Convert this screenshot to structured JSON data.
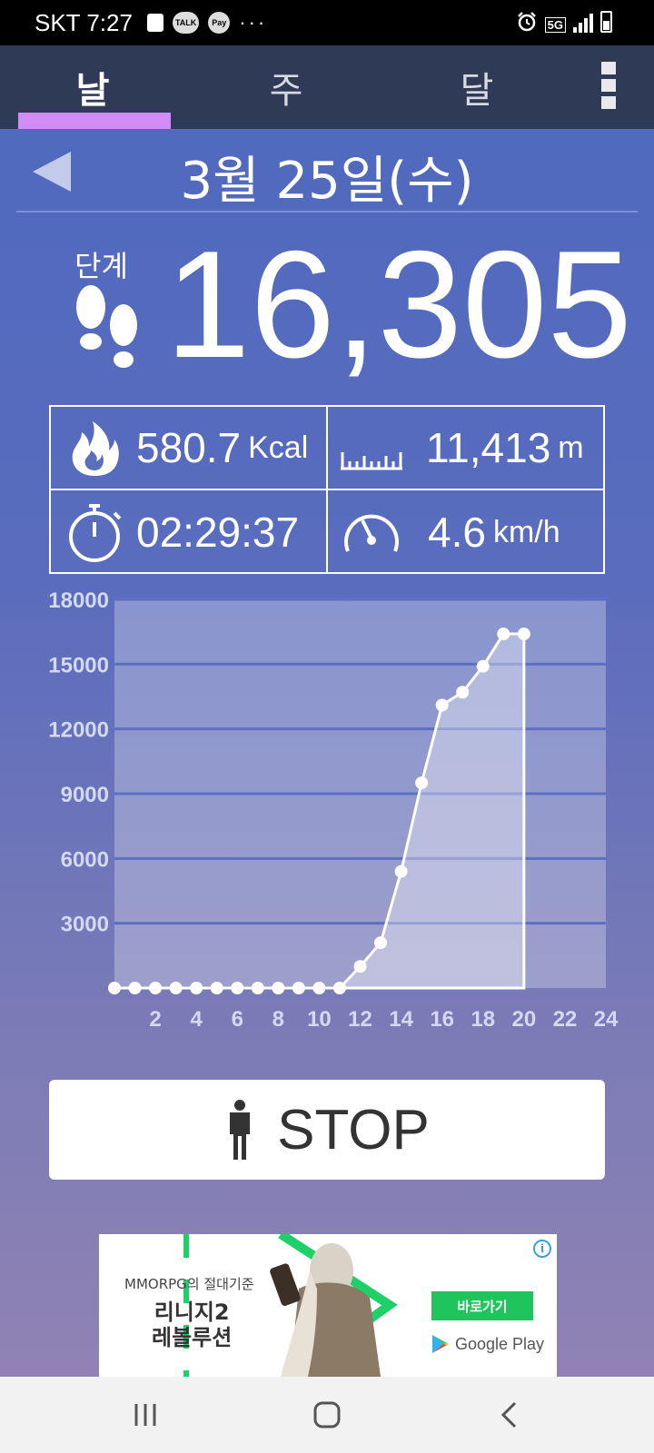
{
  "status_bar": {
    "carrier_time": "SKT 7:27",
    "more": "···",
    "talk_label": "TALK",
    "pay_label": "Pay",
    "network": "5G"
  },
  "tabs": [
    {
      "label": "날",
      "active": true
    },
    {
      "label": "주",
      "active": false
    },
    {
      "label": "달",
      "active": false
    }
  ],
  "date": {
    "label": "3월 25일(수)"
  },
  "steps": {
    "label": "단계",
    "value": "16,305"
  },
  "stats": {
    "calories": {
      "value": "580.7",
      "unit": "Kcal"
    },
    "distance": {
      "value": "11,413",
      "unit": "m"
    },
    "duration": {
      "value": "02:29:37",
      "unit": ""
    },
    "speed": {
      "value": "4.6",
      "unit": "km/h"
    }
  },
  "chart_data": {
    "type": "area",
    "x": [
      0,
      1,
      2,
      3,
      4,
      5,
      6,
      7,
      8,
      9,
      10,
      11,
      12,
      13,
      14,
      15,
      16,
      17,
      18,
      19,
      20
    ],
    "values": [
      0,
      0,
      0,
      0,
      0,
      0,
      0,
      0,
      0,
      0,
      0,
      0,
      1000,
      2100,
      5400,
      9500,
      13100,
      13700,
      14900,
      16400,
      16400
    ],
    "x_ticks": [
      "2",
      "4",
      "6",
      "8",
      "10",
      "12",
      "14",
      "16",
      "18",
      "20",
      "22",
      "24"
    ],
    "y_ticks": [
      "3000",
      "6000",
      "9000",
      "12000",
      "15000",
      "18000"
    ],
    "xlim": [
      0,
      24
    ],
    "ylim": [
      0,
      18000
    ],
    "grid": true,
    "title": "",
    "xlabel": "",
    "ylabel": ""
  },
  "stop_button": {
    "label": "STOP"
  },
  "ad": {
    "tagline": "MMORPG의 절대기준",
    "title_line1": "리니지2",
    "title_line2": "레볼루션",
    "cta": "바로가기",
    "store": "Google Play",
    "info": "i"
  },
  "colors": {
    "tab_indicator": "#d38bf5",
    "tab_bg": "#2f3a57",
    "ad_cta": "#1fc55c"
  }
}
